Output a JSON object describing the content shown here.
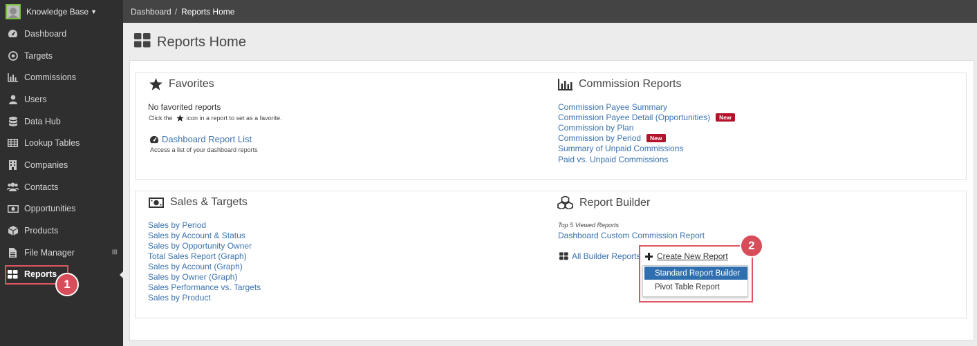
{
  "sidebar": {
    "brand": "Knowledge Base",
    "items": [
      {
        "label": "Dashboard",
        "icon": "dashboard-gauge-icon"
      },
      {
        "label": "Targets",
        "icon": "target-icon"
      },
      {
        "label": "Commissions",
        "icon": "bar-chart-icon"
      },
      {
        "label": "Users",
        "icon": "user-icon"
      },
      {
        "label": "Data Hub",
        "icon": "database-icon"
      },
      {
        "label": "Lookup Tables",
        "icon": "table-icon"
      },
      {
        "label": "Companies",
        "icon": "building-icon"
      },
      {
        "label": "Contacts",
        "icon": "users-icon"
      },
      {
        "label": "Opportunities",
        "icon": "money-icon"
      },
      {
        "label": "Products",
        "icon": "cube-icon"
      },
      {
        "label": "File Manager",
        "icon": "file-icon"
      },
      {
        "label": "Reports",
        "icon": "grid-icon",
        "active": true
      }
    ]
  },
  "callouts": {
    "one": "1",
    "two": "2"
  },
  "breadcrumb": {
    "parent": "Dashboard",
    "separator": "/",
    "current": "Reports Home"
  },
  "page": {
    "title": "Reports Home"
  },
  "favorites": {
    "title": "Favorites",
    "empty": "No favorited reports",
    "hint_before": "Click the",
    "hint_after": "icon in a report to set as a favorite.",
    "dashboard_link": "Dashboard Report List",
    "dashboard_desc": "Access a list of your dashboard reports"
  },
  "commission_reports": {
    "title": "Commission Reports",
    "links": [
      {
        "label": "Commission Payee Summary",
        "badge": ""
      },
      {
        "label": "Commission Payee Detail (Opportunities)",
        "badge": "New"
      },
      {
        "label": "Commission by Plan",
        "badge": ""
      },
      {
        "label": "Commission by Period",
        "badge": "New"
      },
      {
        "label": "Summary of Unpaid Commissions",
        "badge": ""
      },
      {
        "label": "Paid vs. Unpaid Commissions",
        "badge": ""
      }
    ]
  },
  "sales_targets": {
    "title": "Sales & Targets",
    "links": [
      "Sales by Period",
      "Sales by Account & Status",
      "Sales by Opportunity Owner",
      "Total Sales Report (Graph)",
      "Sales by Account (Graph)",
      "Sales by Owner (Graph)",
      "Sales Performance vs. Targets",
      "Sales by Product"
    ]
  },
  "report_builder": {
    "title": "Report Builder",
    "top_label": "Top 5 Viewed Reports",
    "top_links": [
      "Dashboard Custom Commission Report"
    ],
    "all_link": "All Builder Reports",
    "create_label": "Create New Report",
    "menu": [
      "Standard Report Builder",
      "Pivot Table Report"
    ]
  },
  "colors": {
    "link": "#3a73b1",
    "badge": "#b3122b",
    "highlight": "#2f6fb0",
    "callout": "#d84d5a"
  }
}
